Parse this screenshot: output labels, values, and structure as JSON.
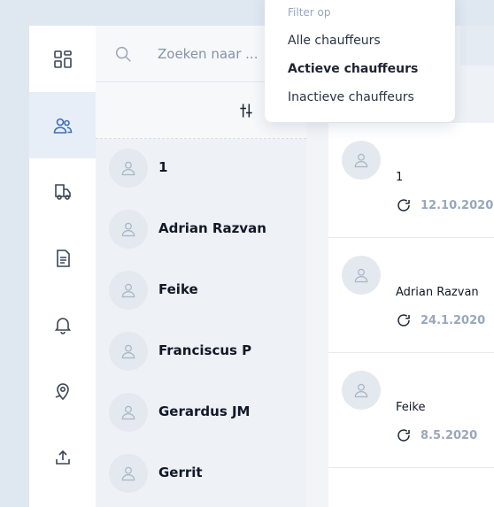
{
  "search": {
    "placeholder": "Zoeken naar ..."
  },
  "nav": {
    "items": [
      {
        "name": "dashboard-icon",
        "active": false
      },
      {
        "name": "users-icon",
        "active": true
      },
      {
        "name": "truck-icon",
        "active": false
      },
      {
        "name": "document-icon",
        "active": false
      },
      {
        "name": "bell-icon",
        "active": false
      },
      {
        "name": "location-icon",
        "active": false
      },
      {
        "name": "upload-icon",
        "active": false
      }
    ]
  },
  "drivers": [
    "1",
    "Adrian Razvan",
    "Feike",
    "Franciscus P",
    "Gerardus JM",
    "Gerrit"
  ],
  "details": [
    {
      "name": "1",
      "date": "12.10.2020"
    },
    {
      "name": "Adrian Razvan",
      "date": "24.1.2020"
    },
    {
      "name": "Feike",
      "date": "8.5.2020"
    }
  ],
  "dropdown": {
    "header": "Filter op",
    "options": [
      {
        "label": "Alle chauffeurs",
        "selected": false
      },
      {
        "label": "Actieve chauffeurs",
        "selected": true
      },
      {
        "label": "Inactieve chauffeurs",
        "selected": false
      }
    ]
  },
  "colors": {
    "accent": "#3a6fb8",
    "date": "#98a7bb",
    "active_nav_bg": "#e8eef7"
  }
}
